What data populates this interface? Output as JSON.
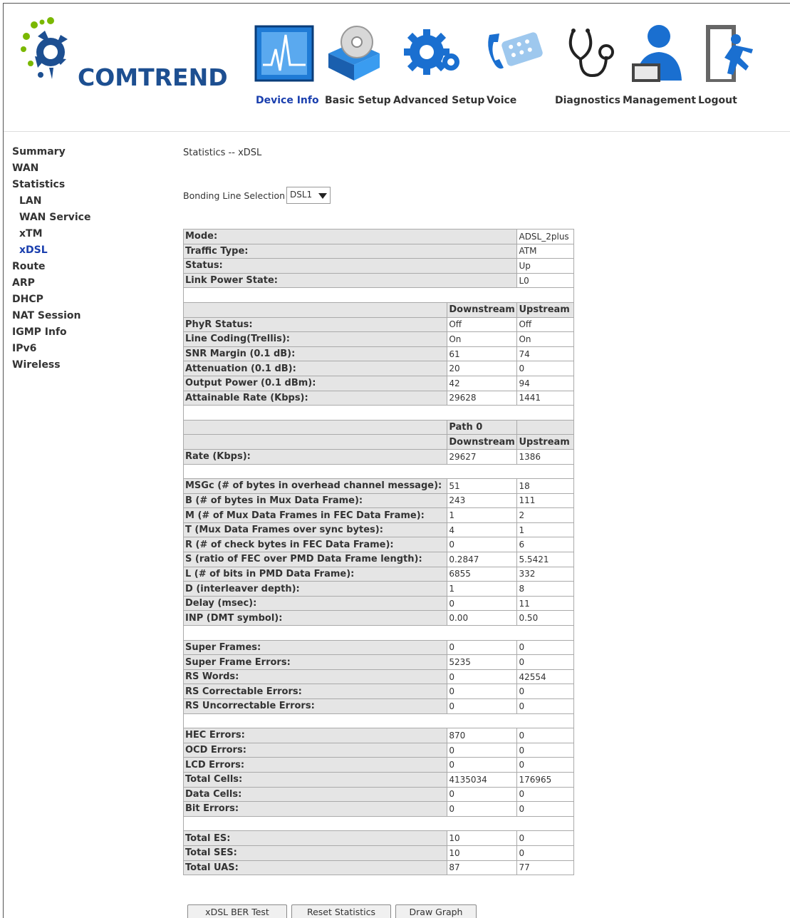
{
  "header": {
    "brand": "COMTREND",
    "nav": [
      {
        "label": "Device Info",
        "active": true,
        "icon": "device-info-icon"
      },
      {
        "label": "Basic Setup",
        "active": false,
        "icon": "basic-setup-icon"
      },
      {
        "label": "Advanced Setup",
        "active": false,
        "icon": "advanced-setup-icon"
      },
      {
        "label": "Voice",
        "active": false,
        "icon": "voice-icon"
      },
      {
        "label": "Diagnostics",
        "active": false,
        "icon": "diagnostics-icon"
      },
      {
        "label": "Management",
        "active": false,
        "icon": "management-icon"
      },
      {
        "label": "Logout",
        "active": false,
        "icon": "logout-icon"
      }
    ]
  },
  "sidebar": {
    "items": [
      {
        "label": "Summary"
      },
      {
        "label": "WAN"
      },
      {
        "label": "Statistics"
      },
      {
        "label": "LAN"
      },
      {
        "label": "WAN Service"
      },
      {
        "label": "xTM"
      },
      {
        "label": "xDSL"
      },
      {
        "label": "Route"
      },
      {
        "label": "ARP"
      },
      {
        "label": "DHCP"
      },
      {
        "label": "NAT Session"
      },
      {
        "label": "IGMP Info"
      },
      {
        "label": "IPv6"
      },
      {
        "label": "Wireless"
      }
    ]
  },
  "main": {
    "title": "Statistics -- xDSL",
    "bonding_label": "Bonding Line Selection",
    "bonding_value": "DSL1",
    "rows": [
      {
        "label": "Mode:",
        "v1": "ADSL_2plus"
      },
      {
        "label": "Traffic Type:",
        "v1": "ATM"
      },
      {
        "label": "Status:",
        "v1": "Up"
      },
      {
        "label": "Link Power State:",
        "v1": "L0"
      },
      {
        "sep": true
      },
      {
        "hdr": true,
        "label": "",
        "v1": "Downstream",
        "v2": "Upstream"
      },
      {
        "label": "PhyR Status:",
        "v1": "Off",
        "v2": "Off"
      },
      {
        "label": "Line Coding(Trellis):",
        "v1": "On",
        "v2": "On"
      },
      {
        "label": "SNR Margin (0.1 dB):",
        "v1": "61",
        "v2": "74"
      },
      {
        "label": "Attenuation (0.1 dB):",
        "v1": "20",
        "v2": "0"
      },
      {
        "label": "Output Power (0.1 dBm):",
        "v1": "42",
        "v2": "94"
      },
      {
        "label": "Attainable Rate (Kbps):",
        "v1": "29628",
        "v2": "1441"
      },
      {
        "sep": true
      },
      {
        "hdr": true,
        "label": "",
        "v1": "Path 0",
        "v2": ""
      },
      {
        "hdr": true,
        "label": "",
        "v1": "Downstream",
        "v2": "Upstream"
      },
      {
        "label": "Rate (Kbps):",
        "v1": "29627",
        "v2": "1386"
      },
      {
        "sep": true
      },
      {
        "label": "MSGc (# of bytes in overhead channel message):",
        "v1": "51",
        "v2": "18"
      },
      {
        "label": "B (# of bytes in Mux Data Frame):",
        "v1": "243",
        "v2": "111"
      },
      {
        "label": "M (# of Mux Data Frames in FEC Data Frame):",
        "v1": "1",
        "v2": "2"
      },
      {
        "label": "T (Mux Data Frames over sync bytes):",
        "v1": "4",
        "v2": "1"
      },
      {
        "label": "R (# of check bytes in FEC Data Frame):",
        "v1": "0",
        "v2": "6"
      },
      {
        "label": "S (ratio of FEC over PMD Data Frame length):",
        "v1": "0.2847",
        "v2": "5.5421"
      },
      {
        "label": "L (# of bits in PMD Data Frame):",
        "v1": "6855",
        "v2": "332"
      },
      {
        "label": "D (interleaver depth):",
        "v1": "1",
        "v2": "8"
      },
      {
        "label": "Delay (msec):",
        "v1": "0",
        "v2": "11"
      },
      {
        "label": "INP (DMT symbol):",
        "v1": "0.00",
        "v2": "0.50"
      },
      {
        "sep": true
      },
      {
        "label": "Super Frames:",
        "v1": "0",
        "v2": "0"
      },
      {
        "label": "Super Frame Errors:",
        "v1": "5235",
        "v2": "0"
      },
      {
        "label": "RS Words:",
        "v1": "0",
        "v2": "42554"
      },
      {
        "label": "RS Correctable Errors:",
        "v1": "0",
        "v2": "0"
      },
      {
        "label": "RS Uncorrectable Errors:",
        "v1": "0",
        "v2": "0"
      },
      {
        "sep": true
      },
      {
        "label": "HEC Errors:",
        "v1": "870",
        "v2": "0"
      },
      {
        "label": "OCD Errors:",
        "v1": "0",
        "v2": "0"
      },
      {
        "label": "LCD Errors:",
        "v1": "0",
        "v2": "0"
      },
      {
        "label": "Total Cells:",
        "v1": "4135034",
        "v2": "176965"
      },
      {
        "label": "Data Cells:",
        "v1": "0",
        "v2": "0"
      },
      {
        "label": "Bit Errors:",
        "v1": "0",
        "v2": "0"
      },
      {
        "sep": true
      },
      {
        "label": "Total ES:",
        "v1": "10",
        "v2": "0"
      },
      {
        "label": "Total SES:",
        "v1": "10",
        "v2": "0"
      },
      {
        "label": "Total UAS:",
        "v1": "87",
        "v2": "77"
      }
    ],
    "buttons": {
      "ber_test": "xDSL BER Test",
      "reset": "Reset Statistics",
      "graph": "Draw Graph"
    }
  },
  "colors": {
    "accent": "#1a3fae",
    "brand": "#1d4f91",
    "label_bg": "#e5e5e5"
  }
}
